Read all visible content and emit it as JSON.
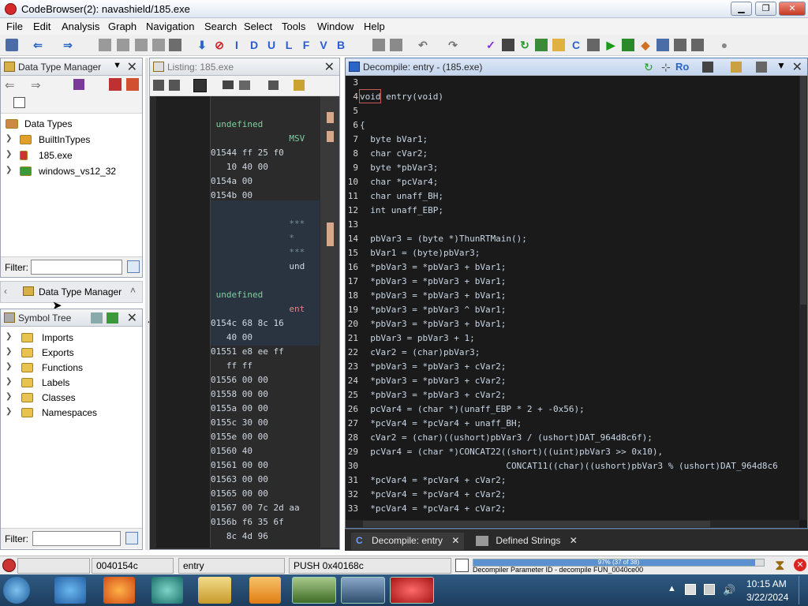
{
  "window": {
    "title": "CodeBrowser(2): navashield/185.exe",
    "min": "▁",
    "max": "❐",
    "close": "✕"
  },
  "menu": [
    "File",
    "Edit",
    "Analysis",
    "Graph",
    "Navigation",
    "Search",
    "Select",
    "Tools",
    "Window",
    "Help"
  ],
  "toolbar_letters": [
    "I",
    "D",
    "U",
    "L",
    "F",
    "V",
    "B"
  ],
  "dtm": {
    "title": "Data Type Manager",
    "root": "Data Types",
    "items": [
      "BuiltInTypes",
      "185.exe",
      "windows_vs12_32"
    ],
    "filter_label": "Filter:"
  },
  "dtm_tab": {
    "label": "Data Type Manager"
  },
  "symtree": {
    "title": "Symbol Tree",
    "items": [
      "Imports",
      "Exports",
      "Functions",
      "Labels",
      "Classes",
      "Namespaces"
    ],
    "filter_label": "Filter:"
  },
  "listing": {
    "title": "Listing:  185.exe",
    "lines": [
      {
        "a": "",
        "t": " undefined",
        "c": "#7dcfa0"
      },
      {
        "a": "",
        "t": "               MSV",
        "c": "#7dcfa0"
      },
      {
        "a": "01544",
        "t": " ff 25 f0",
        "c": "#cfd8e3"
      },
      {
        "a": "",
        "t": "   10 40 00",
        "c": "#cfd8e3"
      },
      {
        "a": "0154a",
        "t": " 00",
        "c": "#cfd8e3"
      },
      {
        "a": "0154b",
        "t": " 00",
        "c": "#cfd8e3"
      },
      {
        "a": "",
        "t": "",
        "c": "#cfd8e3"
      },
      {
        "a": "",
        "t": "               ***",
        "c": "#7a8a99"
      },
      {
        "a": "",
        "t": "               *",
        "c": "#7a8a99"
      },
      {
        "a": "",
        "t": "               ***",
        "c": "#7a8a99"
      },
      {
        "a": "",
        "t": "               und",
        "c": "#cfd8e3"
      },
      {
        "a": "",
        "t": "",
        "c": "#cfd8e3"
      },
      {
        "a": "",
        "t": " undefined",
        "c": "#7dcfa0"
      },
      {
        "a": "",
        "t": "               ent",
        "c": "#d88"
      },
      {
        "a": "0154c",
        "t": " 68 8c 16",
        "c": "#cfd8e3"
      },
      {
        "a": "",
        "t": "   40 00",
        "c": "#cfd8e3"
      },
      {
        "a": "01551",
        "t": " e8 ee ff",
        "c": "#cfd8e3"
      },
      {
        "a": "",
        "t": "   ff ff",
        "c": "#cfd8e3"
      },
      {
        "a": "01556",
        "t": " 00 00",
        "c": "#cfd8e3"
      },
      {
        "a": "01558",
        "t": " 00 00",
        "c": "#cfd8e3"
      },
      {
        "a": "0155a",
        "t": " 00 00",
        "c": "#cfd8e3"
      },
      {
        "a": "0155c",
        "t": " 30 00",
        "c": "#cfd8e3"
      },
      {
        "a": "0155e",
        "t": " 00 00",
        "c": "#cfd8e3"
      },
      {
        "a": "01560",
        "t": " 40",
        "c": "#cfd8e3"
      },
      {
        "a": "01561",
        "t": " 00 00",
        "c": "#cfd8e3"
      },
      {
        "a": "01563",
        "t": " 00 00",
        "c": "#cfd8e3"
      },
      {
        "a": "01565",
        "t": " 00 00",
        "c": "#cfd8e3"
      },
      {
        "a": "01567",
        "t": " 00 7c 2d aa",
        "c": "#cfd8e3"
      },
      {
        "a": "0156b",
        "t": " f6 35 6f",
        "c": "#cfd8e3"
      },
      {
        "a": "",
        "t": "   8c 4d 96",
        "c": "#cfd8e3"
      }
    ]
  },
  "decomp": {
    "title": "Decompile: entry -  (185.exe)",
    "ro": "Ro",
    "lines": [
      {
        "n": "3",
        "t": ""
      },
      {
        "n": "4",
        "t": "void entry(void)"
      },
      {
        "n": "5",
        "t": ""
      },
      {
        "n": "6",
        "t": "{"
      },
      {
        "n": "7",
        "t": "  byte bVar1;"
      },
      {
        "n": "8",
        "t": "  char cVar2;"
      },
      {
        "n": "9",
        "t": "  byte *pbVar3;"
      },
      {
        "n": "10",
        "t": "  char *pcVar4;"
      },
      {
        "n": "11",
        "t": "  char unaff_BH;"
      },
      {
        "n": "12",
        "t": "  int unaff_EBP;"
      },
      {
        "n": "13",
        "t": ""
      },
      {
        "n": "14",
        "t": "  pbVar3 = (byte *)ThunRTMain();"
      },
      {
        "n": "15",
        "t": "  bVar1 = (byte)pbVar3;"
      },
      {
        "n": "16",
        "t": "  *pbVar3 = *pbVar3 + bVar1;"
      },
      {
        "n": "17",
        "t": "  *pbVar3 = *pbVar3 + bVar1;"
      },
      {
        "n": "18",
        "t": "  *pbVar3 = *pbVar3 + bVar1;"
      },
      {
        "n": "19",
        "t": "  *pbVar3 = *pbVar3 ^ bVar1;"
      },
      {
        "n": "20",
        "t": "  *pbVar3 = *pbVar3 + bVar1;"
      },
      {
        "n": "21",
        "t": "  pbVar3 = pbVar3 + 1;"
      },
      {
        "n": "22",
        "t": "  cVar2 = (char)pbVar3;"
      },
      {
        "n": "23",
        "t": "  *pbVar3 = *pbVar3 + cVar2;"
      },
      {
        "n": "24",
        "t": "  *pbVar3 = *pbVar3 + cVar2;"
      },
      {
        "n": "25",
        "t": "  *pbVar3 = *pbVar3 + cVar2;"
      },
      {
        "n": "26",
        "t": "  pcVar4 = (char *)(unaff_EBP * 2 + -0x56);"
      },
      {
        "n": "27",
        "t": "  *pcVar4 = *pcVar4 + unaff_BH;"
      },
      {
        "n": "28",
        "t": "  cVar2 = (char)((ushort)pbVar3 / (ushort)DAT_964d8c6f);"
      },
      {
        "n": "29",
        "t": "  pcVar4 = (char *)CONCAT22((short)((uint)pbVar3 >> 0x10),"
      },
      {
        "n": "30",
        "t": "                            CONCAT11((char)((ushort)pbVar3 % (ushort)DAT_964d8c6"
      },
      {
        "n": "31",
        "t": "  *pcVar4 = *pcVar4 + cVar2;"
      },
      {
        "n": "32",
        "t": "  *pcVar4 = *pcVar4 + cVar2;"
      },
      {
        "n": "33",
        "t": "  *pcVar4 = *pcVar4 + cVar2;"
      }
    ]
  },
  "bottom_tabs": [
    {
      "label": "Decompile: entry",
      "close": "✕"
    },
    {
      "label": "Defined Strings",
      "close": "✕"
    }
  ],
  "status": {
    "address": "0040154c",
    "function": "entry",
    "instruction": "PUSH 0x40168c",
    "progress_text": "97% (37 of 38)",
    "progress": 0.97,
    "message": "Decompiler Parameter ID - decompile FUN_0040ce00"
  },
  "clock": {
    "time": "10:15 AM",
    "date": "3/22/2024"
  }
}
